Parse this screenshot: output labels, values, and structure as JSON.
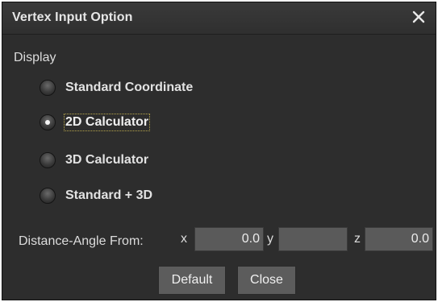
{
  "dialog": {
    "title": "Vertex Input Option"
  },
  "display": {
    "label": "Display",
    "options": [
      {
        "label": "Standard Coordinate",
        "selected": false
      },
      {
        "label": "2D Calculator",
        "selected": true
      },
      {
        "label": "3D Calculator",
        "selected": false
      },
      {
        "label": "Standard + 3D",
        "selected": false
      }
    ]
  },
  "distance": {
    "label": "Distance-Angle From:",
    "x_label": "x",
    "x_value": "0.0",
    "y_label": "y",
    "y_value": "",
    "z_label": "z",
    "z_value": "0.0"
  },
  "buttons": {
    "default_label": "Default",
    "close_label": "Close"
  },
  "icons": {
    "close": "close-icon",
    "radio": "radio-icon"
  }
}
